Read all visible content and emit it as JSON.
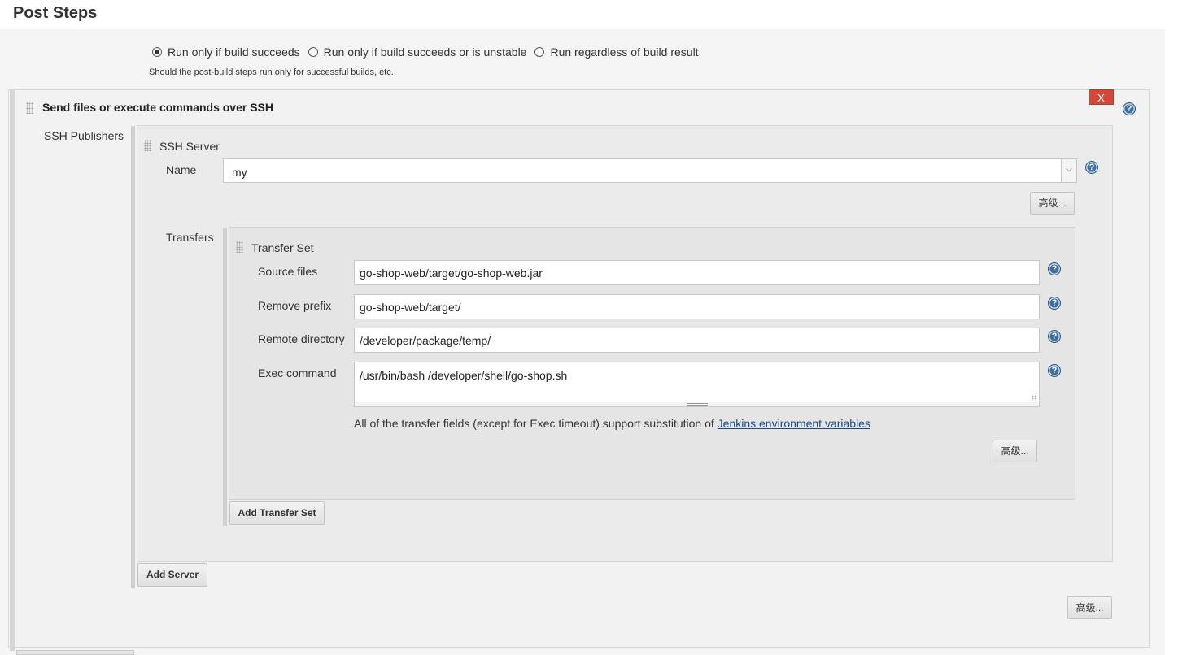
{
  "section": {
    "title": "Post Steps"
  },
  "run_options": [
    {
      "label": "Run only if build succeeds",
      "checked": true
    },
    {
      "label": "Run only if build succeeds or is unstable",
      "checked": false
    },
    {
      "label": "Run regardless of build result",
      "checked": false
    }
  ],
  "run_hint": "Should the post-build steps run only for successful builds, etc.",
  "publisher": {
    "title": "Send files or execute commands over SSH",
    "close_label": "X",
    "publishers_label": "SSH Publishers",
    "advanced_label": "高级...",
    "add_server_label": "Add Server",
    "server": {
      "header": "SSH Server",
      "name_label": "Name",
      "name_value": "my",
      "advanced_label": "高级...",
      "transfers_label": "Transfers",
      "add_transfer_label": "Add Transfer Set",
      "transfer_set": {
        "header": "Transfer Set",
        "source_files_label": "Source files",
        "source_files_value": "go-shop-web/target/go-shop-web.jar",
        "remove_prefix_label": "Remove prefix",
        "remove_prefix_value": "go-shop-web/target/",
        "remote_directory_label": "Remote directory",
        "remote_directory_value": "/developer/package/temp/",
        "exec_command_label": "Exec command",
        "exec_command_value": "/usr/bin/bash /developer/shell/go-shop.sh",
        "note_text": "All of the transfer fields (except for Exec timeout) support substitution of ",
        "note_link": "Jenkins environment variables",
        "advanced_label": "高级..."
      }
    }
  },
  "help_glyph": "?",
  "colors": {
    "close_button": "#d24939",
    "help_icon": "#3e6ea0",
    "link": "#204a87"
  }
}
